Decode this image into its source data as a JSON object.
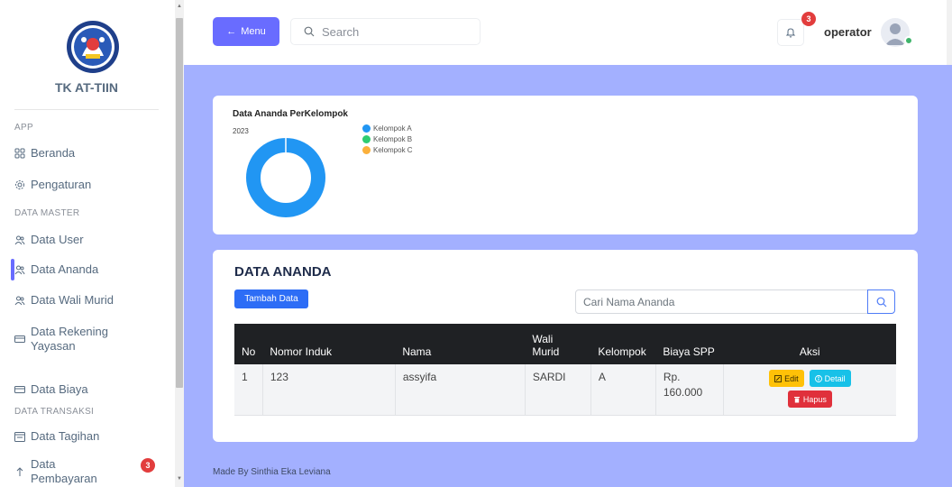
{
  "sidebar": {
    "brand": "TK AT-TIIN",
    "sections": {
      "app": "APP",
      "master": "DATA MASTER",
      "transaksi": "DATA TRANSAKSI"
    },
    "items": [
      {
        "label": "Beranda",
        "icon": "grid-icon"
      },
      {
        "label": "Pengaturan",
        "icon": "gear-icon"
      },
      {
        "label": "Data User",
        "icon": "users-icon"
      },
      {
        "label": "Data Ananda",
        "icon": "users-icon"
      },
      {
        "label": "Data Wali Murid",
        "icon": "users-icon"
      },
      {
        "label": "Data Rekening Yayasan",
        "icon": "card-icon"
      },
      {
        "label": "Data Biaya",
        "icon": "card-icon"
      },
      {
        "label": "Data Tagihan",
        "icon": "calendar-icon"
      },
      {
        "label": "Data Pembayaran",
        "icon": "arrow-up-icon"
      }
    ],
    "pembayaran_badge": "3"
  },
  "topbar": {
    "menu_label": "Menu",
    "search_placeholder": "Search",
    "notif_count": "3",
    "username": "operator"
  },
  "chart_card": {
    "title": "Data Ananda PerKelompok"
  },
  "chart_data": {
    "type": "pie",
    "title": "Data Ananda PerKelompok",
    "subtitle": "2023",
    "categories": [
      "Kelompok A",
      "Kelompok B",
      "Kelompok C"
    ],
    "values": [
      1,
      0,
      0
    ],
    "colors": [
      "#2196f3",
      "#2ecc71",
      "#fbb03b"
    ],
    "donut": true,
    "legend": "top-right"
  },
  "table_card": {
    "title": "DATA ANANDA",
    "add_label": "Tambah Data",
    "search_placeholder": "Cari Nama Ananda",
    "columns": [
      "No",
      "Nomor Induk",
      "Nama",
      "Wali Murid",
      "Kelompok",
      "Biaya SPP",
      "Aksi"
    ],
    "rows": [
      {
        "no": "1",
        "nomor_induk": "123",
        "nama": "assyifa",
        "wali": "SARDI",
        "kelompok": "A",
        "biaya": "Rp. 160.000"
      }
    ],
    "actions": {
      "edit": "Edit",
      "detail": "Detail",
      "hapus": "Hapus"
    }
  },
  "footer": "Made By Sinthia Eka Leviana",
  "colors": {
    "primary": "#696cff",
    "content_bg": "#a3b0ff",
    "danger": "#e0303b",
    "warning": "#ffc107",
    "info": "#17c1e8"
  }
}
